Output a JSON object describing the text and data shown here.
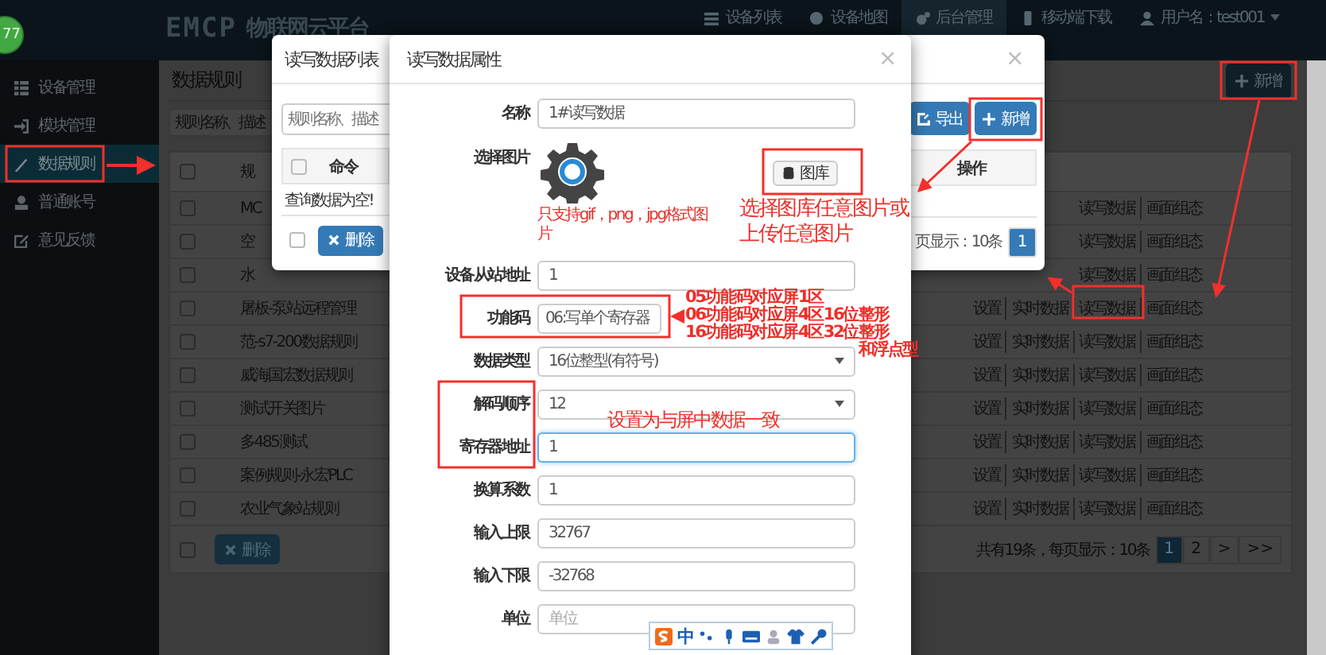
{
  "badge": "77",
  "topbar": {
    "logo": "EMCP",
    "brand": "物联网云平台",
    "nav": [
      {
        "label": "设备列表",
        "selected": false
      },
      {
        "label": "设备地图",
        "selected": false
      },
      {
        "label": "后台管理",
        "selected": true
      },
      {
        "label": "移动端下载",
        "selected": false
      },
      {
        "label": "用户名：test001",
        "selected": false
      }
    ]
  },
  "sidebar": {
    "items": [
      {
        "label": "设备管理",
        "selected": false
      },
      {
        "label": "模块管理",
        "selected": false
      },
      {
        "label": "数据规则",
        "selected": true
      },
      {
        "label": "普通账号",
        "selected": false
      },
      {
        "label": "意见反馈",
        "selected": false
      }
    ]
  },
  "page": {
    "title": "数据规则",
    "add_button": "新增",
    "search": {
      "placeholder": "规则名称、描述"
    },
    "table": {
      "header_checked": false,
      "columns": [
        "规"
      ],
      "rows": [
        {
          "checked": false,
          "name": "MC",
          "actions": [
            "读写数据",
            "画面组态"
          ]
        },
        {
          "checked": false,
          "name": "空",
          "actions": [
            "读写数据",
            "画面组态"
          ]
        },
        {
          "checked": false,
          "name": "水",
          "actions": [
            "读写数据",
            "画面组态"
          ]
        },
        {
          "checked": false,
          "name": "屠板-泵站远程管理",
          "actions": [
            "设置",
            "实时数据",
            "读写数据",
            "画面组态"
          ]
        },
        {
          "checked": false,
          "name": "范-s7-200数据规则",
          "actions": [
            "设置",
            "实时数据",
            "读写数据",
            "画面组态"
          ]
        },
        {
          "checked": false,
          "name": "威海国宏数据规则",
          "actions": [
            "设置",
            "实时数据",
            "读写数据",
            "画面组态"
          ]
        },
        {
          "checked": false,
          "name": "测试开关图片",
          "actions": [
            "设置",
            "实时数据",
            "读写数据",
            "画面组态"
          ]
        },
        {
          "checked": false,
          "name": "多485测试",
          "actions": [
            "设置",
            "实时数据",
            "读写数据",
            "画面组态"
          ]
        },
        {
          "checked": false,
          "name": "案例规则-永宏PLC",
          "actions": [
            "设置",
            "实时数据",
            "读写数据",
            "画面组态"
          ]
        },
        {
          "checked": false,
          "name": "农业气象站规则",
          "actions": [
            "设置",
            "实时数据",
            "读写数据",
            "画面组态"
          ]
        }
      ]
    },
    "footer_checked": false,
    "delete_button": "删除",
    "pagination": {
      "summary": "共有19条，每页显示：10条",
      "pages": [
        {
          "label": "1",
          "selected": true
        },
        {
          "label": "2",
          "selected": false
        },
        {
          "label": ">",
          "selected": false
        },
        {
          "label": ">>",
          "selected": false
        }
      ]
    }
  },
  "list_dialog": {
    "title": "读写数据列表",
    "close": "×",
    "search": {
      "placeholder": "规则名称、描述"
    },
    "export_button": "导出",
    "add_button": "新增",
    "header_checked": false,
    "columns": [
      "命令",
      "操作"
    ],
    "empty": "查询数据为空!",
    "footer_checked": false,
    "delete_button": "删除",
    "page_info": "页显示：10条",
    "pages": [
      {
        "label": "1",
        "selected": true
      }
    ]
  },
  "property_dialog": {
    "title": "读写数据属性",
    "close": "×",
    "fields": [
      {
        "kind": "input",
        "label": "名称",
        "value": "1#读写数据",
        "focused": false
      },
      {
        "kind": "image",
        "label": "选择图片",
        "button": "图库",
        "hint": "只支持gif，png，jpg格式图片"
      },
      {
        "kind": "input",
        "label": "设备从站地址",
        "value": "1",
        "focused": false
      },
      {
        "kind": "short-input",
        "label": "功能码",
        "value": "06:写单个寄存器",
        "focused": false
      },
      {
        "kind": "select",
        "label": "数据类型",
        "value": "16位整型(有符号)"
      },
      {
        "kind": "select",
        "label": "解码顺序",
        "value": "12"
      },
      {
        "kind": "input",
        "label": "寄存器地址",
        "value": "1",
        "focused": true
      },
      {
        "kind": "input",
        "label": "换算系数",
        "value": "1",
        "focused": false
      },
      {
        "kind": "input",
        "label": "输入上限",
        "value": "32767",
        "focused": false
      },
      {
        "kind": "input",
        "label": "输入下限",
        "value": "-32768",
        "focused": false
      },
      {
        "kind": "input",
        "label": "单位",
        "placeholder": "单位",
        "focused": false
      }
    ]
  },
  "annotations": {
    "gallery_note": [
      "选择图库任意图片或",
      "上传任意图片"
    ],
    "function_code_note": [
      "05功能码对应屏1区",
      "06功能码对应屏4区16位整形",
      "16功能码对应屏4区32位整形",
      "和浮点型"
    ],
    "address_note": "设置为与屏中数据一致"
  },
  "ime_toolbar": {
    "mode": "中"
  }
}
